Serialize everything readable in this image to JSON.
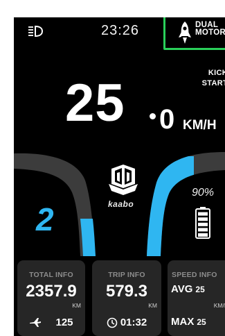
{
  "status": {
    "time": "23:26",
    "mode_line1": "DUAL",
    "mode_line2": "MOTOR",
    "headlight_icon": "headlight-icon",
    "mode_icon": "rocket-icon"
  },
  "kick_start": {
    "line1": "KICK",
    "line2": "START"
  },
  "speed": {
    "integer": "25",
    "decimal": "0",
    "unit": "KM/H"
  },
  "gear": "2",
  "brand": "kaabo",
  "battery": {
    "percent_text": "90%",
    "level": 0.9
  },
  "panels": {
    "total": {
      "title": "TOTAL INFO",
      "value": "2357.9",
      "unit": "KM",
      "foot_value": "125",
      "foot_icon": "airplane-icon"
    },
    "trip": {
      "title": "TRIP INFO",
      "value": "579.3",
      "unit": "KM",
      "time": "01:32",
      "foot_icon": "clock-icon"
    },
    "speed": {
      "title": "SPEED INFO",
      "avg_label": "AVG",
      "avg_value": "25",
      "unit": "KM/H",
      "max_label": "MAX",
      "max_value": "25"
    }
  },
  "colors": {
    "accent_blue": "#2fb6f1",
    "highlight_green": "#2ad05a",
    "panel_bg": "#262626"
  }
}
